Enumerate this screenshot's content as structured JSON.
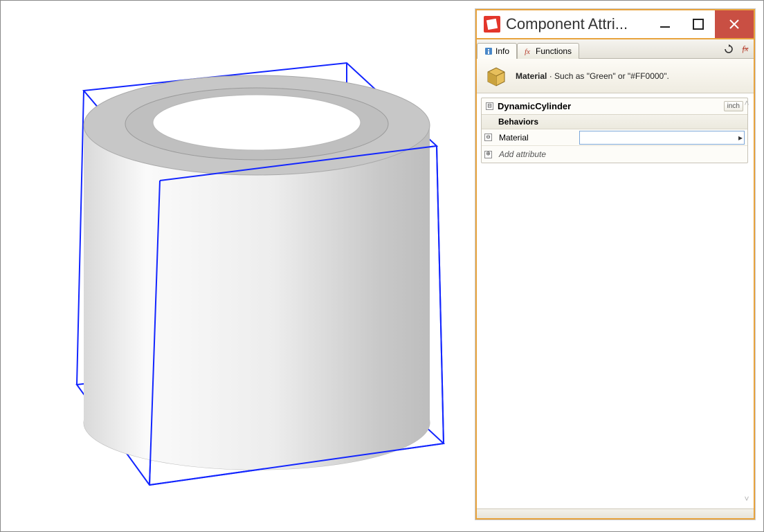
{
  "window": {
    "title": "Component Attri..."
  },
  "tabs": {
    "info": "Info",
    "functions": "Functions"
  },
  "description": {
    "label": "Material",
    "text": " · Such as \"Green\" or \"#FF0000\"."
  },
  "component": {
    "name": "DynamicCylinder",
    "unit_badge": "inch",
    "section_label": "Behaviors",
    "attributes": {
      "material": {
        "label": "Material",
        "value": ""
      }
    },
    "add_label": "Add attribute"
  },
  "toggles": {
    "collapse": "⊟",
    "remove": "⊖",
    "add": "⊕"
  }
}
